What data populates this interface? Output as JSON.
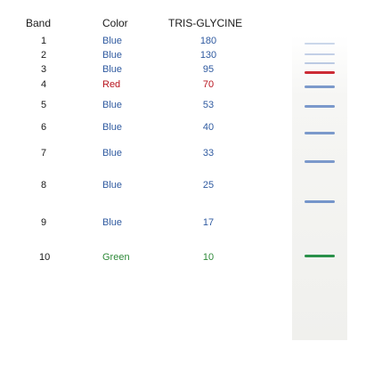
{
  "headers": {
    "band": "Band",
    "color": "Color",
    "buffer": "TRIS-GLYCINE"
  },
  "colors": {
    "blue": "#2f5aa0",
    "red": "#b8141e",
    "green": "#2f8a3a",
    "dark": "#1a1a1a"
  },
  "rows": [
    {
      "band": "1",
      "color": "Blue",
      "mw": "180"
    },
    {
      "band": "2",
      "color": "Blue",
      "mw": "130"
    },
    {
      "band": "3",
      "color": "Blue",
      "mw": "95"
    },
    {
      "band": "4",
      "color": "Red",
      "mw": "70"
    },
    {
      "band": "5",
      "color": "Blue",
      "mw": "53"
    },
    {
      "band": "6",
      "color": "Blue",
      "mw": "40"
    },
    {
      "band": "7",
      "color": "Blue",
      "mw": "33"
    },
    {
      "band": "8",
      "color": "Blue",
      "mw": "25"
    },
    {
      "band": "9",
      "color": "Blue",
      "mw": "17"
    },
    {
      "band": "10",
      "color": "Green",
      "mw": "10"
    }
  ],
  "gel_bands": [
    {
      "band": "1",
      "color": "Blue"
    },
    {
      "band": "2",
      "color": "Blue"
    },
    {
      "band": "3",
      "color": "Blue"
    },
    {
      "band": "4",
      "color": "Red"
    },
    {
      "band": "5",
      "color": "Blue"
    },
    {
      "band": "6",
      "color": "Blue"
    },
    {
      "band": "7",
      "color": "Blue"
    },
    {
      "band": "8",
      "color": "Blue"
    },
    {
      "band": "9",
      "color": "Blue"
    },
    {
      "band": "10",
      "color": "Green"
    }
  ]
}
